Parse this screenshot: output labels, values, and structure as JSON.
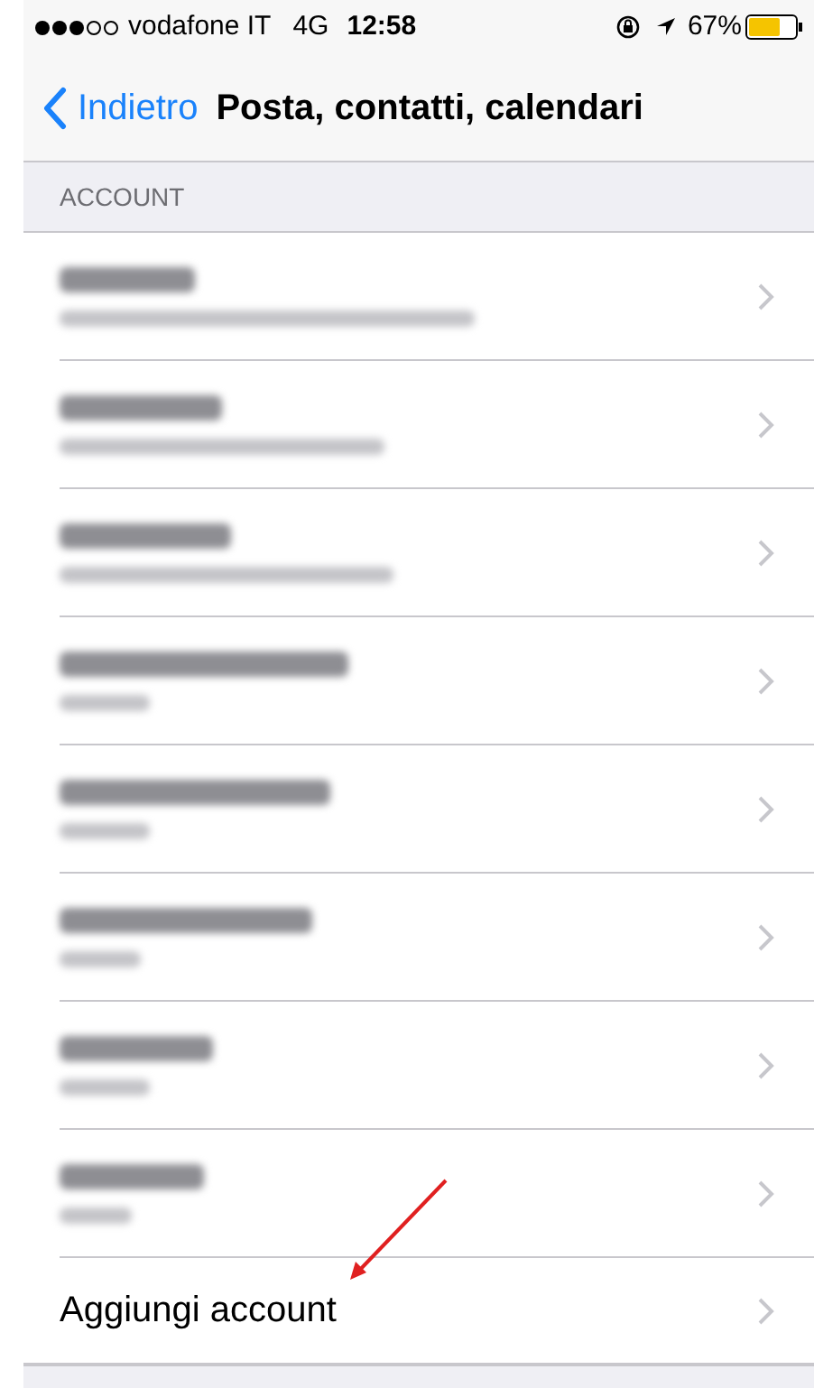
{
  "status_bar": {
    "carrier": "vodafone IT",
    "network": "4G",
    "time": "12:58",
    "battery": "67%"
  },
  "nav": {
    "back": "Indietro",
    "title": "Posta, contatti, calendari"
  },
  "section": {
    "header": "ACCOUNT"
  },
  "accounts": [
    {
      "blurred": true
    },
    {
      "blurred": true
    },
    {
      "blurred": true
    },
    {
      "blurred": true
    },
    {
      "blurred": true
    },
    {
      "blurred": true
    },
    {
      "blurred": true
    },
    {
      "blurred": true
    }
  ],
  "add_account": {
    "label": "Aggiungi account"
  },
  "annotations": [
    {
      "kind": "arrow"
    }
  ]
}
